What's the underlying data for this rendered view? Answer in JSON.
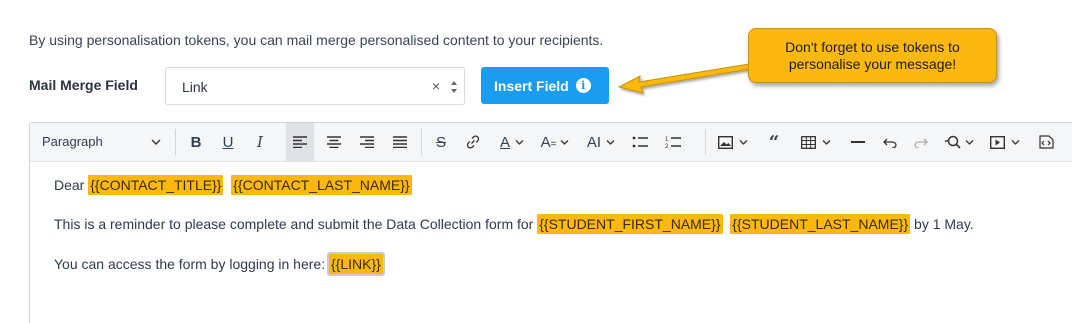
{
  "intro_text": "By using personalisation tokens, you can mail merge personalised content to your recipients.",
  "mail_merge": {
    "label": "Mail Merge Field",
    "selected_value": "Link",
    "clear_glyph": "×"
  },
  "insert_button": {
    "label": "Insert Field",
    "info_glyph": "i"
  },
  "callout": {
    "line1": "Don't forget to use tokens to",
    "line2": "personalise your message!",
    "color": "#fbb80f"
  },
  "toolbar": {
    "paragraph_label": "Paragraph",
    "buttons": [
      "bold",
      "underline",
      "italic",
      "align-left",
      "align-center",
      "align-right",
      "justify",
      "strikethrough",
      "link",
      "font-color",
      "font-size",
      "font-family",
      "bulleted-list",
      "numbered-list",
      "image",
      "blockquote",
      "table",
      "horizontal-line",
      "undo",
      "redo",
      "find-replace",
      "media",
      "source"
    ]
  },
  "body": {
    "line1": {
      "prefix": "Dear ",
      "token1": "{{CONTACT_TITLE}}",
      "token2": "{{CONTACT_LAST_NAME}}"
    },
    "line2": {
      "prefix": "This is a reminder to please complete and submit the Data Collection form for ",
      "token1": "{{STUDENT_FIRST_NAME}}",
      "token2": "{{STUDENT_LAST_NAME}}",
      "suffix": " by 1 May."
    },
    "line3": {
      "prefix": "You can access the form by logging in here: ",
      "token1": "{{LINK}}"
    }
  },
  "colors": {
    "accent": "#1a9cf0",
    "token": "#fbb80f"
  }
}
